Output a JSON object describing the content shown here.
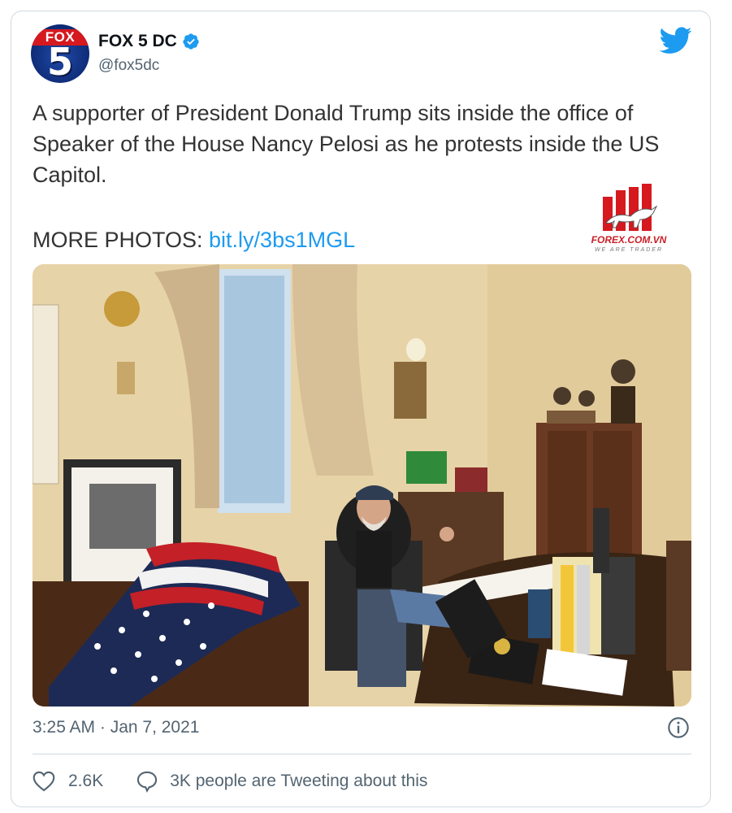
{
  "tweet": {
    "author": {
      "display_name": "FOX 5 DC",
      "handle": "@fox5dc",
      "verified": true,
      "avatar_brand": "FOX",
      "avatar_number": "5"
    },
    "text": "A supporter of President Donald Trump sits inside the office of Speaker of the House Nancy Pelosi as he protests inside the US Capitol.",
    "more_photos_label": "MORE PHOTOS: ",
    "more_photos_link": "bit.ly/3bs1MGL",
    "timestamp": "3:25 AM · Jan 7, 2021",
    "like_count": "2.6K",
    "tweeting_text": "3K people are Tweeting about this"
  },
  "watermark": {
    "name": "FOREX.COM.VN",
    "tagline": "WE ARE TRADER"
  },
  "icons": {
    "platform": "twitter-bird-icon",
    "verified": "verified-badge-icon",
    "info": "info-icon",
    "like": "heart-icon",
    "reply": "speech-bubble-icon"
  },
  "colors": {
    "link": "#1d9bf0",
    "brand_blue": "#1d9bf0",
    "muted": "#536471",
    "border": "#cfd9de",
    "fox_red": "#d6191f",
    "watermark_red": "#c91f26"
  }
}
